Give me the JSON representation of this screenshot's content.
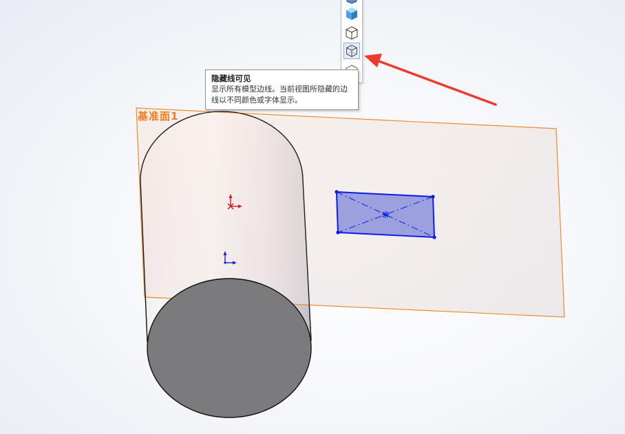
{
  "tooltip": {
    "title": "隐藏线可见",
    "body": "显示所有模型边线。当前视图所隐藏的边线以不同颜色或字体显示。"
  },
  "plane": {
    "label": "基准面1"
  },
  "toolbar": {
    "buttons": [
      {
        "name": "shaded-icon"
      },
      {
        "name": "wireframe-cube-icon"
      },
      {
        "name": "hidden-lines-visible-icon",
        "state": "hover"
      }
    ]
  },
  "colors": {
    "plane_label": "#f07d1e",
    "plane_border": "#f08a2a",
    "sketch": "#0a1de8",
    "sketch_fill": "#7f86d8",
    "arrow": "#f03a2e",
    "cylinder_face": "#7b7a7c"
  }
}
